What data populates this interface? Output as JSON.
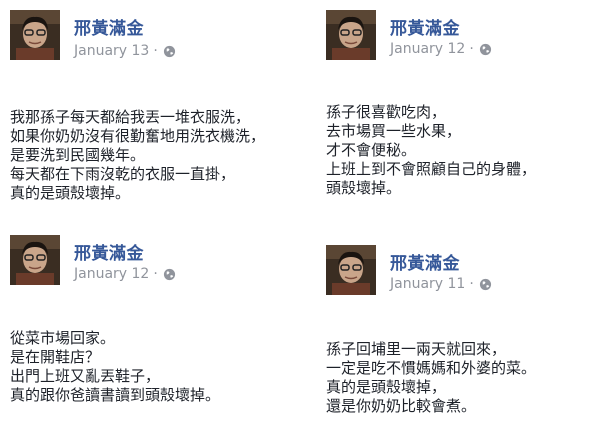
{
  "posts": [
    {
      "author": "邢黃滿金",
      "date": "January 13",
      "separator": "·",
      "privacy_icon": "globe-icon",
      "lines": [
        "我那孫子每天都給我丟一堆衣服洗，",
        "如果你奶奶沒有很勤奮地用洗衣機洗，",
        "是要洗到民國幾年。",
        "每天都在下雨沒乾的衣服一直掛，",
        "真的是頭殼壞掉。"
      ]
    },
    {
      "author": "邢黃滿金",
      "date": "January 12",
      "separator": "·",
      "privacy_icon": "globe-icon",
      "lines": [
        "孫子很喜歡吃肉，",
        "去市場買一些水果，",
        "才不會便秘。",
        "上班上到不會照顧自己的身體，",
        "頭殼壞掉。"
      ]
    },
    {
      "author": "邢黃滿金",
      "date": "January 12",
      "separator": "·",
      "privacy_icon": "globe-icon",
      "lines": [
        "從菜市場回家。",
        "是在開鞋店？",
        "出門上班又亂丟鞋子，",
        "真的跟你爸讀書讀到頭殼壞掉。"
      ]
    },
    {
      "author": "邢黃滿金",
      "date": "January 11",
      "separator": "·",
      "privacy_icon": "globe-icon",
      "lines": [
        "孫子回埔里一兩天就回來，",
        "一定是吃不慣媽媽和外婆的菜。",
        "真的是頭殼壞掉，",
        "還是你奶奶比較會煮。"
      ]
    }
  ],
  "colors": {
    "author_link": "#365899",
    "meta_text": "#90949c",
    "body_text": "#1d2129"
  }
}
